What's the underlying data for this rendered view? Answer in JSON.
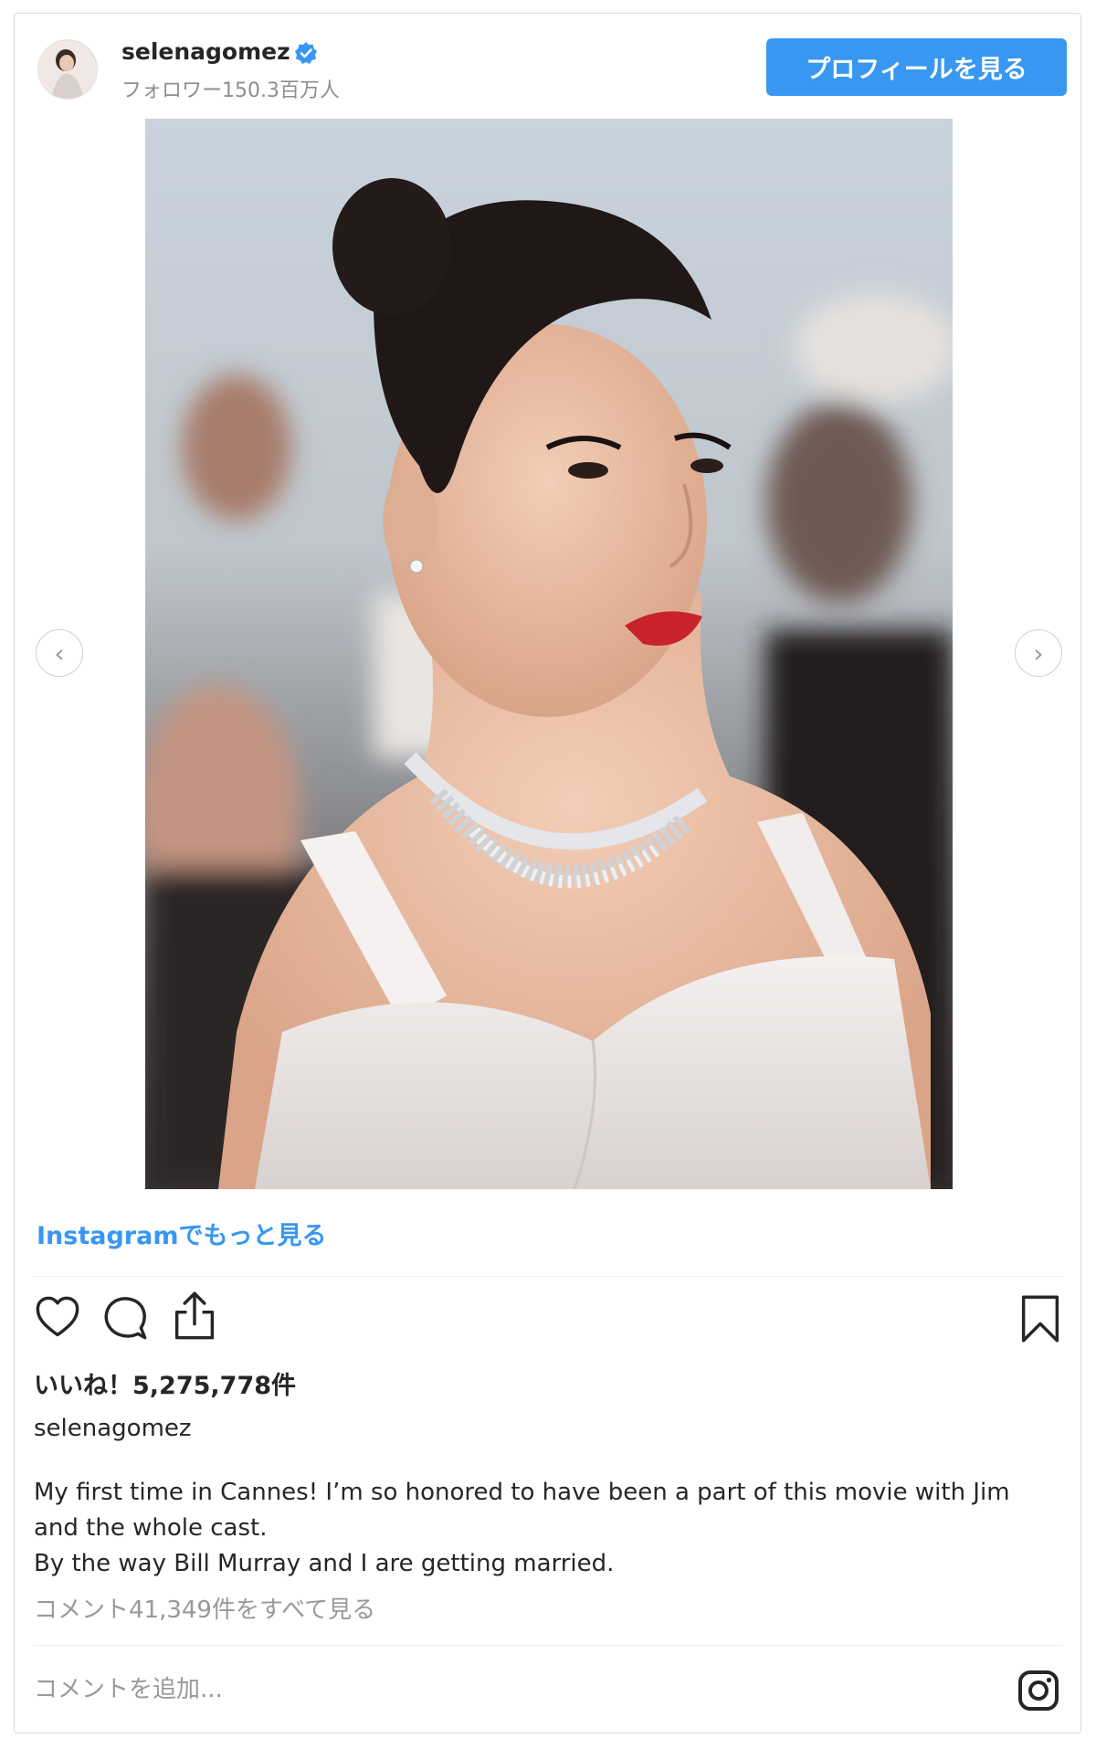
{
  "header": {
    "username": "selenagomez",
    "followers": "フォロワー150.3百万人",
    "profile_button": "プロフィールを見る"
  },
  "post": {
    "more_link": "Instagramでもっと見る",
    "likes": "いいね！5,275,778件",
    "caption_user": "selenagomez",
    "caption_lines": [
      "My first time in Cannes! I’m so honored to have been a part of this movie with Jim",
      "and the whole cast.",
      "By the way Bill Murray and I are getting married."
    ],
    "view_comments": "コメント41,349件をすべて見る",
    "comment_placeholder": "コメントを追加..."
  },
  "icons": {
    "like": "heart-icon",
    "comment": "comment-icon",
    "share": "share-icon",
    "save": "bookmark-icon",
    "instagram": "instagram-logo-icon",
    "verified": "verified-badge-icon",
    "prev": "chevron-left-icon",
    "next": "chevron-right-icon"
  },
  "colors": {
    "accent": "#3897f0",
    "text": "#262626",
    "muted": "#8e8e8e",
    "lips": "#c8232c"
  }
}
